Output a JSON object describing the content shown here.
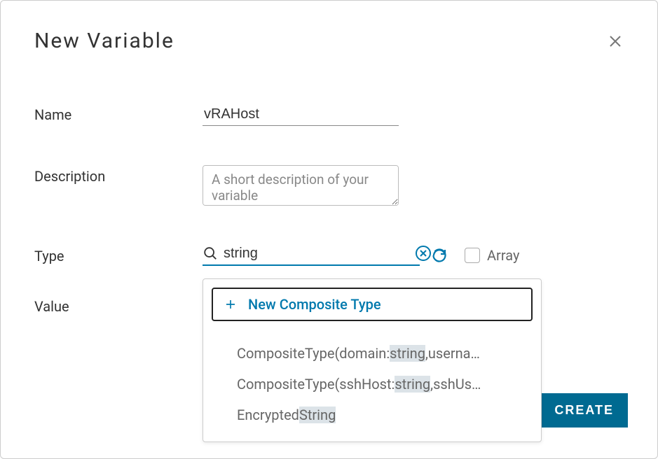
{
  "dialog": {
    "title": "New Variable",
    "create_label": "CREATE"
  },
  "form": {
    "name_label": "Name",
    "name_value": "vRAHost",
    "description_label": "Description",
    "description_placeholder": "A short description of your variable",
    "type_label": "Type",
    "type_value": "string",
    "array_label": "Array",
    "value_label": "Value"
  },
  "dropdown": {
    "new_composite_label": "New Composite Type",
    "items": [
      {
        "pre": "CompositeType(domain:",
        "match": "string",
        "post": ",userna…"
      },
      {
        "pre": "CompositeType(sshHost:",
        "match": "string",
        "post": ",sshUs…"
      },
      {
        "pre": "Encrypted",
        "match": "String",
        "post": ""
      }
    ]
  }
}
